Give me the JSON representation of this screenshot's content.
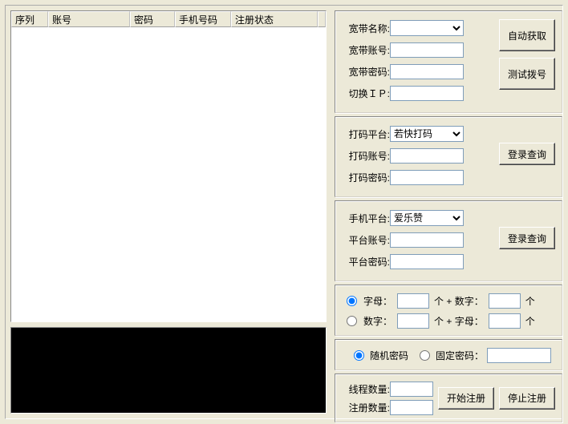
{
  "table": {
    "headers": [
      "序列",
      "账号",
      "密码",
      "手机号码",
      "注册状态",
      ""
    ]
  },
  "broadband": {
    "name_label": "宽带名称:",
    "account_label": "宽带账号:",
    "password_label": "宽带密码:",
    "switchip_label": "切换ＩＰ:",
    "name_value": "",
    "account_value": "",
    "password_value": "",
    "switchip_value": "",
    "auto_btn": "自动获取",
    "test_btn": "测试拨号"
  },
  "captcha": {
    "platform_label": "打码平台:",
    "account_label": "打码账号:",
    "password_label": "打码密码:",
    "platform_value": "若快打码",
    "account_value": "",
    "password_value": "",
    "login_btn": "登录查询"
  },
  "phone": {
    "platform_label": "手机平台:",
    "account_label": "平台账号:",
    "password_label": "平台密码:",
    "platform_value": "爱乐赞",
    "account_value": "",
    "password_value": "",
    "login_btn": "登录查询"
  },
  "gen": {
    "letter_label": "字母：",
    "digit_label": "数字：",
    "mid1": "个 + 数字：",
    "mid2": "个 + 字母：",
    "tail": "个",
    "v1": "",
    "v2": "",
    "v3": "",
    "v4": ""
  },
  "pwd": {
    "random_label": "随机密码",
    "fixed_label": "固定密码：",
    "fixed_value": ""
  },
  "run": {
    "thread_label": "线程数量:",
    "reg_label": "注册数量:",
    "thread_value": "",
    "reg_value": "",
    "start_btn": "开始注册",
    "stop_btn": "停止注册"
  }
}
